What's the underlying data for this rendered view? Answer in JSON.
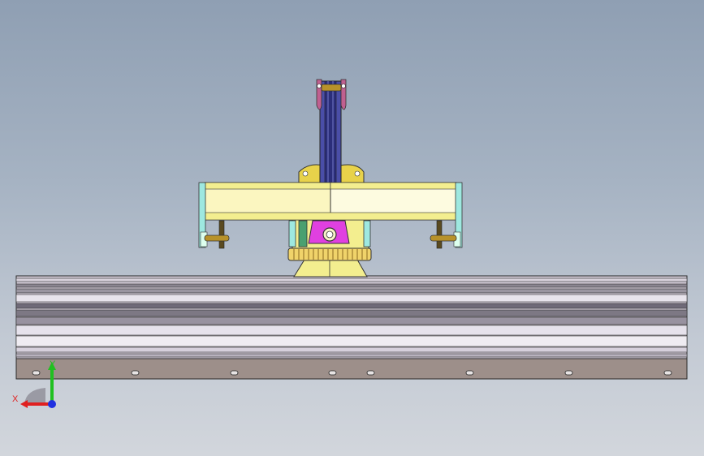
{
  "viewport": {
    "background_top": "#8f9fb3",
    "background_bottom": "#d2d6dc"
  },
  "model": {
    "colors": {
      "beam_light": "#fbf6c0",
      "beam_yellow": "#f3ee8f",
      "cyan_end": "#9ee8e0",
      "column_blue": "#4a4ea8",
      "column_dark": "#2b2e7a",
      "magenta_head": "#e040e0",
      "gold_pin": "#b8922a",
      "gear_ring": "#f0d36a",
      "rail_light": "#e6e2ec",
      "rail_grey": "#8a8590",
      "rail_base": "#9d8f8a"
    }
  },
  "triad": {
    "x_label": "X",
    "y_label": "Y",
    "x_color": "#e02020",
    "y_color": "#20c020",
    "z_color": "#2030e0"
  }
}
